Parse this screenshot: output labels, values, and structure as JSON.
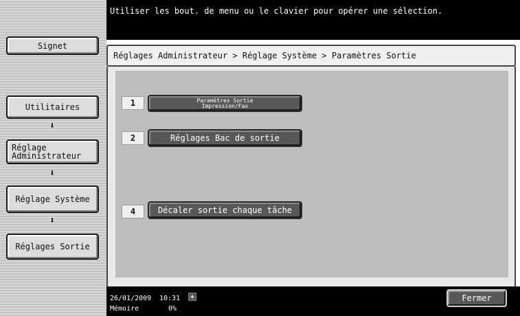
{
  "header": {
    "message": "Utiliser les bout. de menu ou le clavier pour opérer une sélection.",
    "breadcrumb": "Réglages Administrateur > Réglage Système > Paramètres Sortie"
  },
  "sidebar": {
    "bookmark_label": "Signet",
    "items": [
      {
        "label": "Utilitaires"
      },
      {
        "line1": "Réglage",
        "line2": "Administrateur"
      },
      {
        "label": "Réglage Système"
      },
      {
        "label": "Réglages Sortie"
      }
    ],
    "arrow": "⬇"
  },
  "options": [
    {
      "number": "1",
      "line1": "Paramètres Sortie",
      "line2": "Impression/Fax"
    },
    {
      "number": "2",
      "label": "Réglages Bac de sortie"
    },
    {
      "number": "4",
      "label": "Décaler sortie chaque tâche"
    }
  ],
  "footer": {
    "date": "26/01/2009",
    "time": "10:31",
    "memory_label": "Mémoire",
    "memory_value": "0%",
    "network_icon": "network-icon",
    "close_label": "Fermer"
  },
  "colors": {
    "topbar": "#000000",
    "option_button": "#585858",
    "panel": "#bdbdbd"
  }
}
